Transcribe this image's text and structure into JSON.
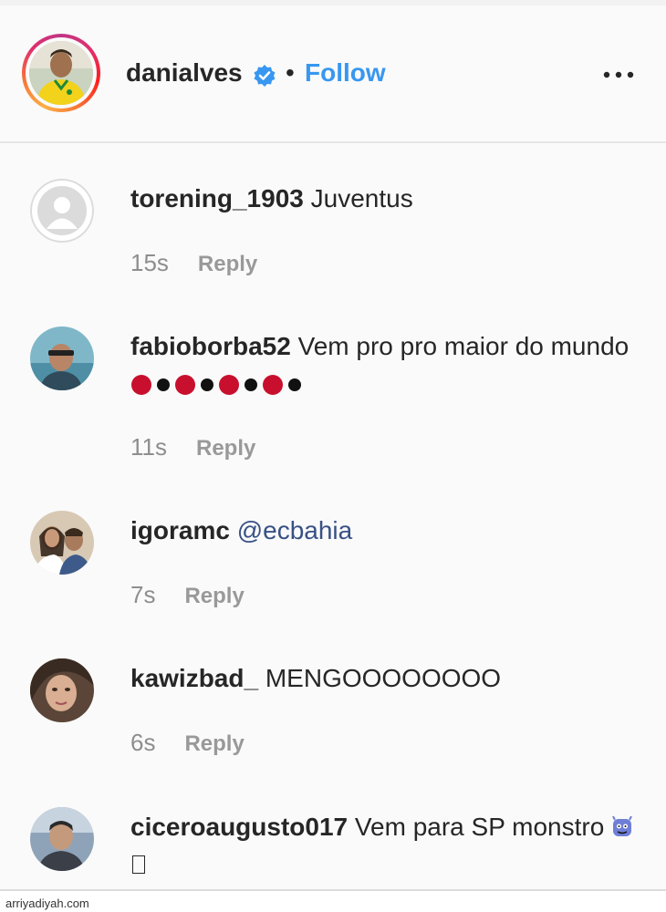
{
  "post_header": {
    "username": "danialves",
    "separator": "•",
    "follow_label": "Follow",
    "verified_icon": "verified-badge-icon",
    "more_icon": "more-options-icon"
  },
  "comments": [
    {
      "username": "torening_1903",
      "text": " Juventus",
      "time": "15s",
      "reply_label": "Reply",
      "avatar": "default-avatar"
    },
    {
      "username": "fabioborba52",
      "text": " Vem pro pro maior do mundo ",
      "time": "11s",
      "reply_label": "Reply",
      "avatar": "user-photo",
      "emoji": [
        "red-circle",
        "black-circle",
        "red-circle",
        "black-circle",
        "red-circle",
        "black-circle",
        "red-circle",
        "black-circle"
      ]
    },
    {
      "username": "igoramc",
      "mention": "@ecbahia",
      "time": "7s",
      "reply_label": "Reply",
      "avatar": "user-photo"
    },
    {
      "username": "kawizbad_",
      "text": " MENGOOOOOOOO",
      "time": "6s",
      "reply_label": "Reply",
      "avatar": "user-photo"
    },
    {
      "username": "ciceroaugusto017",
      "text": " Vem para SP monstro ",
      "avatar": "user-photo",
      "emoji": [
        "monster-face",
        "unknown-glyph"
      ]
    }
  ],
  "watermark": "arriyadiyah.com",
  "colors": {
    "follow": "#3897f0",
    "verified": "#3897f0",
    "emoji_red": "#c8102e",
    "emoji_black": "#111111",
    "muted": "#999999"
  }
}
